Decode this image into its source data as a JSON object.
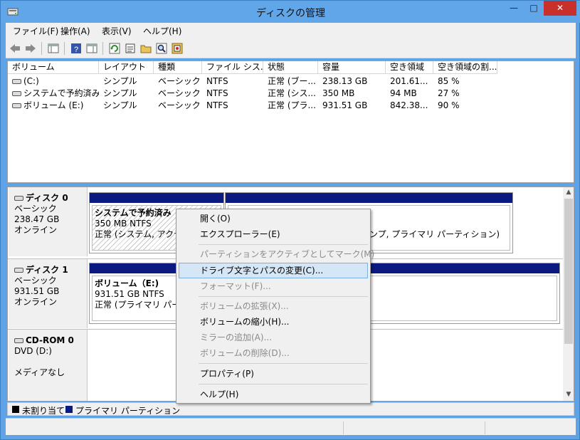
{
  "window": {
    "title": "ディスクの管理",
    "min_glyph": "—",
    "max_glyph": "□",
    "close_glyph": "✕"
  },
  "menubar": [
    "ファイル(F)",
    "操作(A)",
    "表示(V)",
    "ヘルプ(H)"
  ],
  "toolbar_icons": [
    "back-arrow-icon",
    "forward-arrow-icon",
    "console-tree-icon",
    "help-icon",
    "properties-pane-icon",
    "refresh-icon",
    "properties-icon",
    "open-folder-icon",
    "search-icon",
    "export-icon"
  ],
  "volume_list": {
    "columns": [
      "ボリューム",
      "レイアウト",
      "種類",
      "ファイル シス...",
      "状態",
      "容量",
      "空き領域",
      "空き領域の割..."
    ],
    "rows": [
      [
        "(C:)",
        "シンプル",
        "ベーシック",
        "NTFS",
        "正常 (ブー...",
        "238.13 GB",
        "201.61...",
        "85 %"
      ],
      [
        "システムで予約済み...",
        "シンプル",
        "ベーシック",
        "NTFS",
        "正常 (シス...",
        "350 MB",
        "94 MB",
        "27 %"
      ],
      [
        "ボリューム (E:)",
        "シンプル",
        "ベーシック",
        "NTFS",
        "正常 (プラ...",
        "931.51 GB",
        "842.38...",
        "90 %"
      ]
    ]
  },
  "disks": [
    {
      "name": "ディスク 0",
      "type": "ベーシック",
      "size": "238.47 GB",
      "status": "オンライン",
      "partitions": [
        {
          "name": "システムで予約済み（F",
          "fs": "350 MB NTFS",
          "status": "正常 (システム, アクティブ"
        },
        {
          "name": "",
          "fs": "",
          "status": "ンプ, プライマリ パーティション)"
        }
      ]
    },
    {
      "name": "ディスク 1",
      "type": "ベーシック",
      "size": "931.51 GB",
      "status": "オンライン",
      "partitions": [
        {
          "name": "ボリューム（E:)",
          "fs": "931.51 GB NTFS",
          "status": "正常 (プライマリ パーティ"
        }
      ]
    },
    {
      "name": "CD-ROM 0",
      "type": "DVD (D:)",
      "size": "",
      "status": "メディアなし"
    }
  ],
  "legend": [
    {
      "label": "未割り当て",
      "color": "#000000"
    },
    {
      "label": "プライマリ パーティション",
      "color": "#0a1a80"
    }
  ],
  "context_menu": {
    "items": [
      {
        "label": "開く(O)",
        "enabled": true
      },
      {
        "label": "エクスプローラー(E)",
        "enabled": true
      },
      {
        "label": "パーティションをアクティブとしてマーク(M)",
        "enabled": false
      },
      {
        "label": "ドライブ文字とパスの変更(C)...",
        "enabled": true,
        "highlighted": true
      },
      {
        "label": "フォーマット(F)...",
        "enabled": false
      },
      {
        "label": "ボリュームの拡張(X)...",
        "enabled": false
      },
      {
        "label": "ボリュームの縮小(H)...",
        "enabled": true
      },
      {
        "label": "ミラーの追加(A)...",
        "enabled": false
      },
      {
        "label": "ボリュームの削除(D)...",
        "enabled": false
      },
      {
        "label": "プロパティ(P)",
        "enabled": true
      },
      {
        "label": "ヘルプ(H)",
        "enabled": true
      }
    ]
  },
  "scroll": {
    "up_glyph": "▲",
    "down_glyph": "▼"
  }
}
